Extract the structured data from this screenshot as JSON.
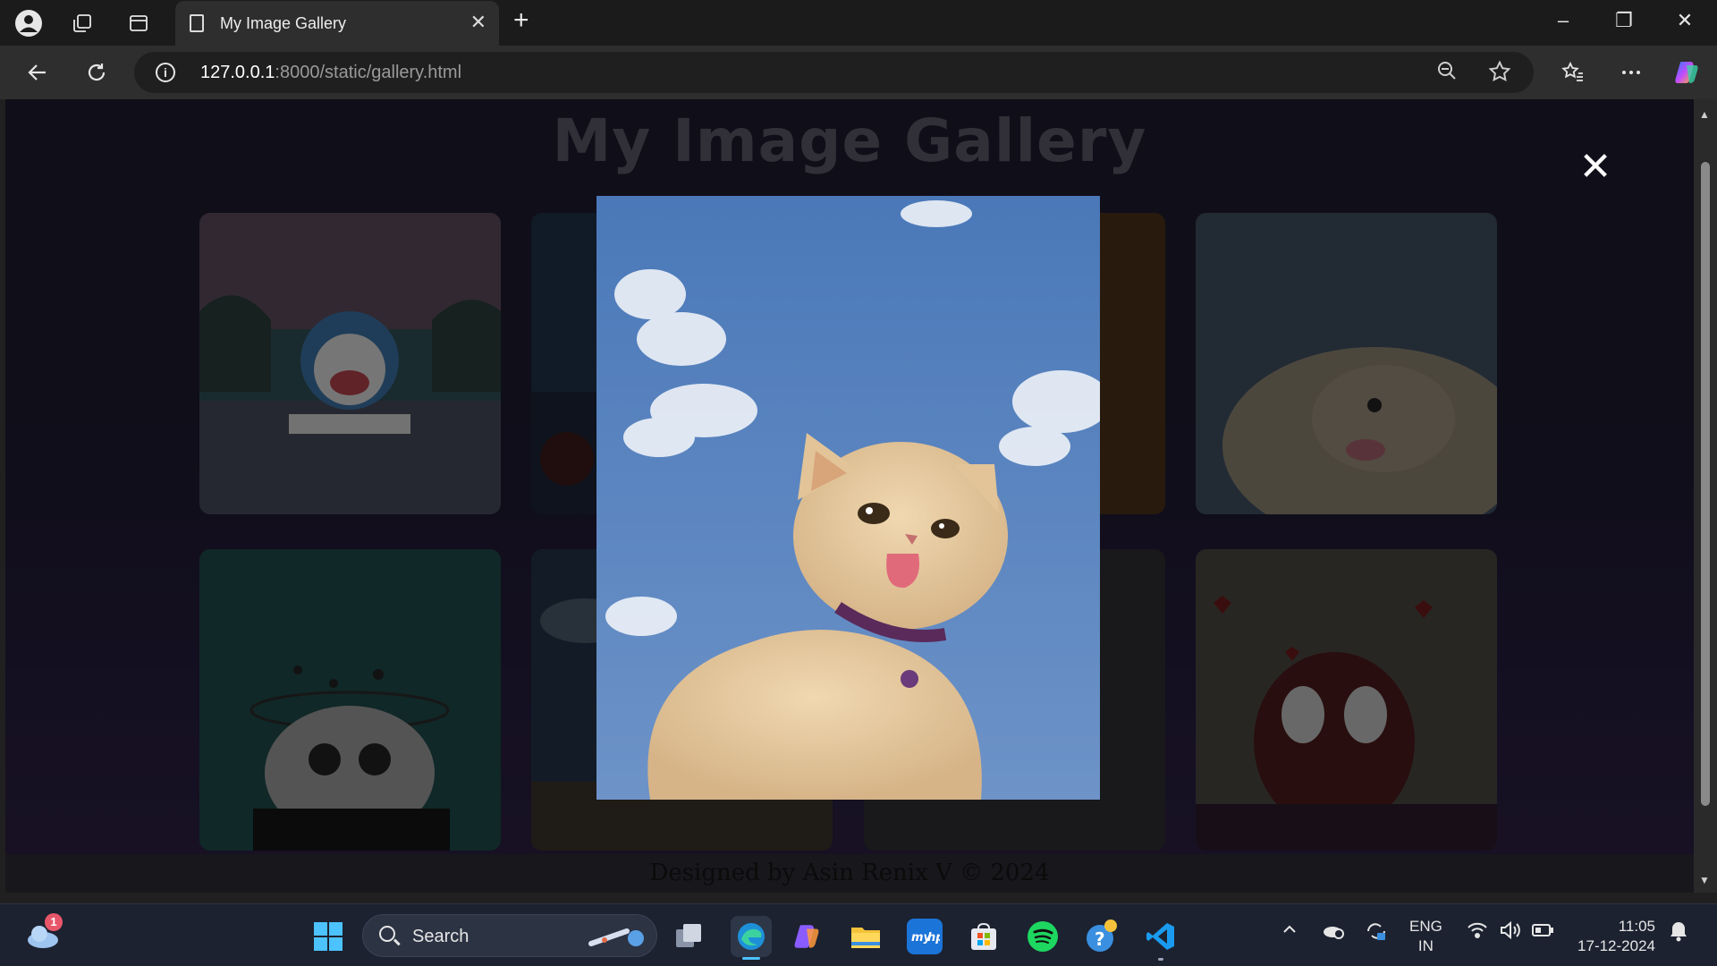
{
  "tab": {
    "title": "My Image Gallery",
    "close": "✕",
    "new": "+"
  },
  "window_controls": {
    "minimize": "–",
    "restore": "❐",
    "close": "✕"
  },
  "address_bar": {
    "host": "127.0.0.1",
    "rest": ":8000/static/gallery.html"
  },
  "page": {
    "title": "My Image Gallery",
    "footer": "Designed by Asin Renix V © 2024",
    "modal_close": "✕"
  },
  "taskbar": {
    "search_placeholder": "Search",
    "weather_badge": "1",
    "language_line1": "ENG",
    "language_line2": "IN",
    "time": "11:05",
    "date": "17-12-2024"
  },
  "colors": {
    "accent": "#0078d4",
    "page_bg": "#1e1b2e",
    "title": "#5a5866"
  }
}
